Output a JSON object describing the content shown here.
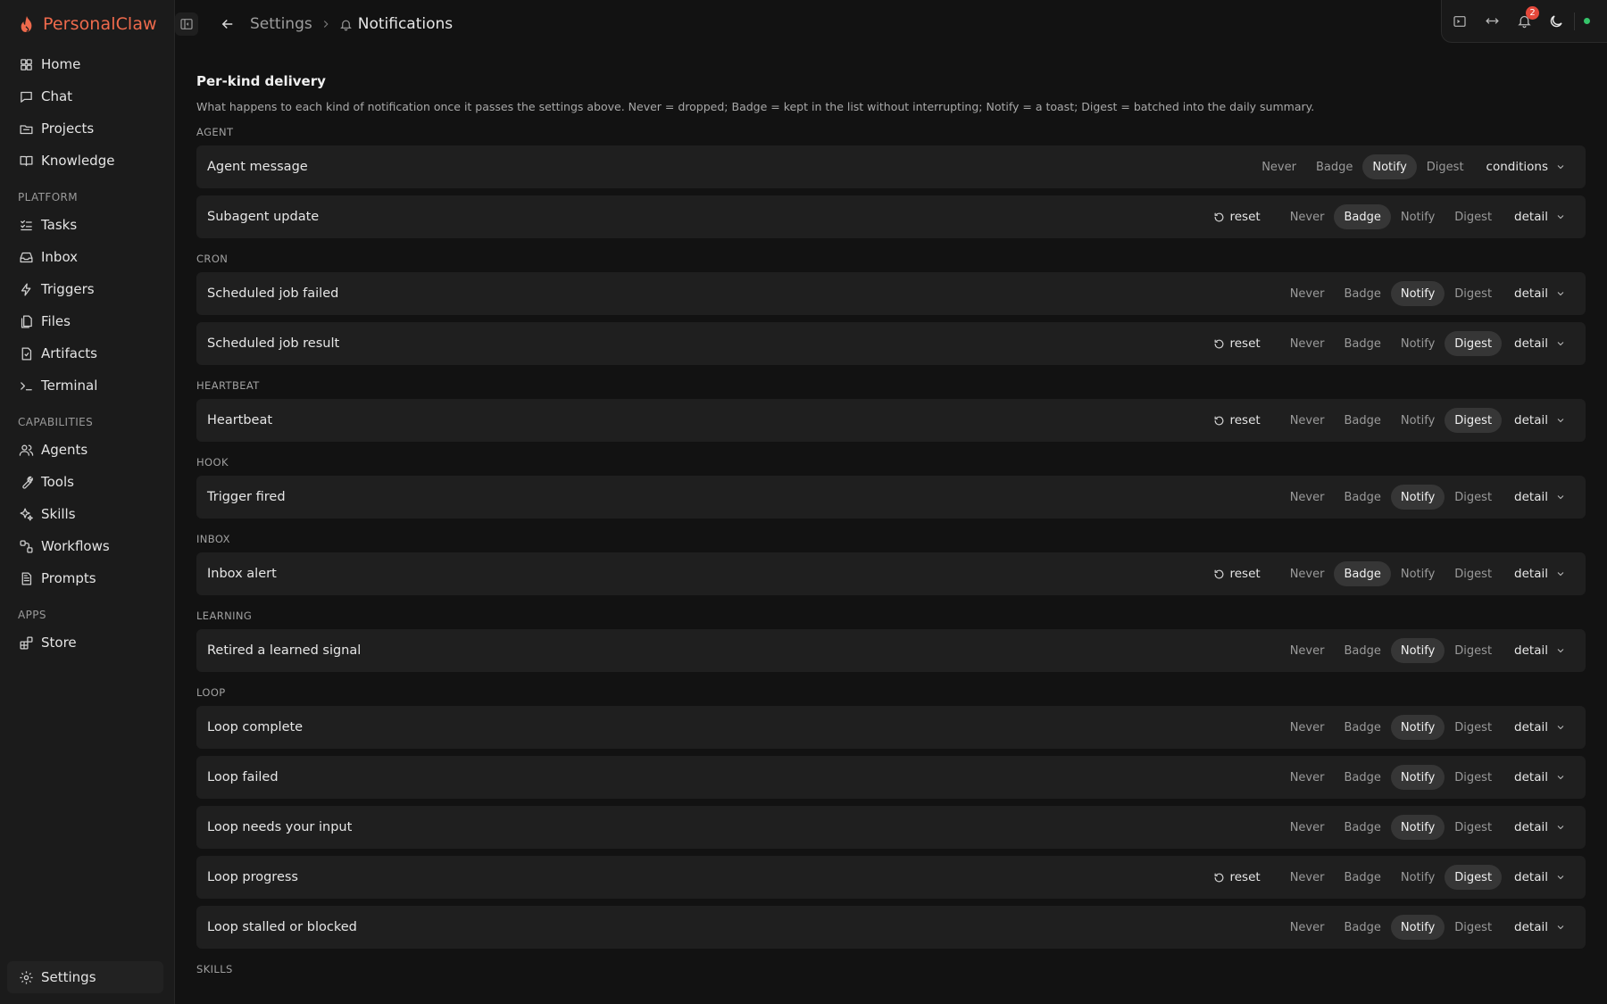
{
  "brand": {
    "name": "PersonalClaw",
    "accent": "#ef6a4c"
  },
  "nav": {
    "primary": [
      {
        "label": "Home",
        "icon": "home-icon"
      },
      {
        "label": "Chat",
        "icon": "chat-icon"
      },
      {
        "label": "Projects",
        "icon": "projects-icon"
      },
      {
        "label": "Knowledge",
        "icon": "book-icon"
      }
    ],
    "sections": [
      {
        "label": "PLATFORM",
        "items": [
          {
            "label": "Tasks",
            "icon": "tasks-icon"
          },
          {
            "label": "Inbox",
            "icon": "inbox-icon"
          },
          {
            "label": "Triggers",
            "icon": "zap-icon"
          },
          {
            "label": "Files",
            "icon": "files-icon"
          },
          {
            "label": "Artifacts",
            "icon": "artifact-icon"
          },
          {
            "label": "Terminal",
            "icon": "terminal-icon"
          }
        ]
      },
      {
        "label": "CAPABILITIES",
        "items": [
          {
            "label": "Agents",
            "icon": "agents-icon"
          },
          {
            "label": "Tools",
            "icon": "wrench-icon"
          },
          {
            "label": "Skills",
            "icon": "sparkle-icon"
          },
          {
            "label": "Workflows",
            "icon": "workflow-icon"
          },
          {
            "label": "Prompts",
            "icon": "document-icon"
          }
        ]
      },
      {
        "label": "APPS",
        "items": [
          {
            "label": "Store",
            "icon": "store-icon"
          }
        ]
      }
    ],
    "settings": "Settings"
  },
  "header": {
    "crumb_settings": "Settings",
    "crumb_current": "Notifications",
    "notification_count": "2"
  },
  "page": {
    "title": "Per-kind delivery",
    "description": "What happens to each kind of notification once it passes the settings above. Never = dropped; Badge = kept in the list without interrupting; Notify = a toast; Digest = batched into the daily summary.",
    "options": [
      "Never",
      "Badge",
      "Notify",
      "Digest"
    ],
    "reset_label": "reset",
    "groups": [
      {
        "label": "AGENT",
        "rows": [
          {
            "label": "Agent message",
            "selected": "Notify",
            "reset": false,
            "more": "conditions"
          },
          {
            "label": "Subagent update",
            "selected": "Badge",
            "reset": true,
            "more": "detail"
          }
        ]
      },
      {
        "label": "CRON",
        "rows": [
          {
            "label": "Scheduled job failed",
            "selected": "Notify",
            "reset": false,
            "more": "detail"
          },
          {
            "label": "Scheduled job result",
            "selected": "Digest",
            "reset": true,
            "more": "detail"
          }
        ]
      },
      {
        "label": "HEARTBEAT",
        "rows": [
          {
            "label": "Heartbeat",
            "selected": "Digest",
            "reset": true,
            "more": "detail"
          }
        ]
      },
      {
        "label": "HOOK",
        "rows": [
          {
            "label": "Trigger fired",
            "selected": "Notify",
            "reset": false,
            "more": "detail"
          }
        ]
      },
      {
        "label": "INBOX",
        "rows": [
          {
            "label": "Inbox alert",
            "selected": "Badge",
            "reset": true,
            "more": "detail"
          }
        ]
      },
      {
        "label": "LEARNING",
        "rows": [
          {
            "label": "Retired a learned signal",
            "selected": "Notify",
            "reset": false,
            "more": "detail"
          }
        ]
      },
      {
        "label": "LOOP",
        "rows": [
          {
            "label": "Loop complete",
            "selected": "Notify",
            "reset": false,
            "more": "detail"
          },
          {
            "label": "Loop failed",
            "selected": "Notify",
            "reset": false,
            "more": "detail"
          },
          {
            "label": "Loop needs your input",
            "selected": "Notify",
            "reset": false,
            "more": "detail"
          },
          {
            "label": "Loop progress",
            "selected": "Digest",
            "reset": true,
            "more": "detail"
          },
          {
            "label": "Loop stalled or blocked",
            "selected": "Notify",
            "reset": false,
            "more": "detail"
          }
        ]
      },
      {
        "label": "SKILLS",
        "rows": []
      }
    ]
  }
}
